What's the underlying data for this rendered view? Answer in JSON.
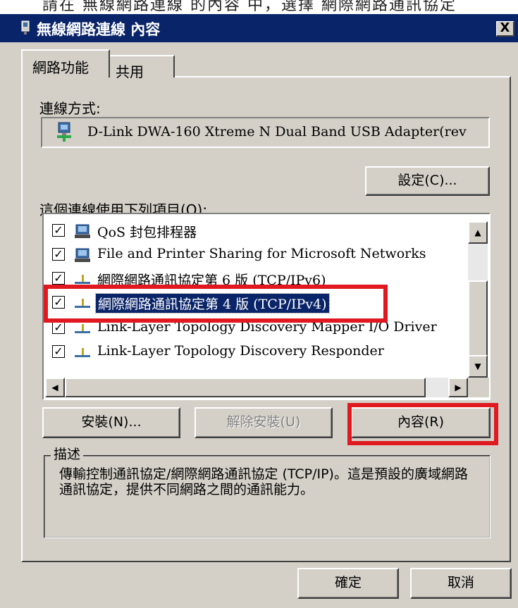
{
  "top_strip_text": "請在 無線網路連線 的內容 中，選擇 網際網路通訊協定",
  "title_bar": {
    "title": "無線網路連線 內容",
    "close_label": "X"
  },
  "tabs": [
    {
      "label": "網路功能"
    },
    {
      "label": "共用"
    }
  ],
  "connect_using": {
    "label": "連線方式:",
    "adapter_name": "D-Link DWA-160 Xtreme N Dual Band USB Adapter(rev",
    "configure_label": "設定(C)..."
  },
  "components": {
    "label": "這個連線使用下列項目(O):",
    "items": [
      {
        "label": "QoS 封包排程器",
        "checked": true,
        "icon": "network-client-icon"
      },
      {
        "label": "File and Printer Sharing for Microsoft Networks",
        "checked": true,
        "icon": "network-client-icon"
      },
      {
        "label": "網際網路通訊協定第 6 版 (TCP/IPv6)",
        "checked": true,
        "icon": "protocol-icon"
      },
      {
        "label": "網際網路通訊協定第 4 版 (TCP/IPv4)",
        "checked": true,
        "icon": "protocol-icon",
        "selected": true
      },
      {
        "label": "Link-Layer Topology Discovery Mapper I/O Driver",
        "checked": true,
        "icon": "protocol-icon"
      },
      {
        "label": "Link-Layer Topology Discovery Responder",
        "checked": true,
        "icon": "protocol-icon"
      }
    ]
  },
  "buttons": {
    "install": "安裝(N)...",
    "uninstall": "解除安裝(U)",
    "properties": "內容(R)",
    "ok": "確定",
    "cancel": "取消"
  },
  "description": {
    "legend": "描述",
    "text": "傳輸控制通訊協定/網際網路通訊協定 (TCP/IP)。這是預設的廣域網路通訊協定，提供不同網路之間的通訊能力。"
  },
  "colors": {
    "title_bar": "#0a246a",
    "dialog_face": "#d4d0c8",
    "selection": "#0a246a",
    "highlight_annotation": "#e01820"
  }
}
